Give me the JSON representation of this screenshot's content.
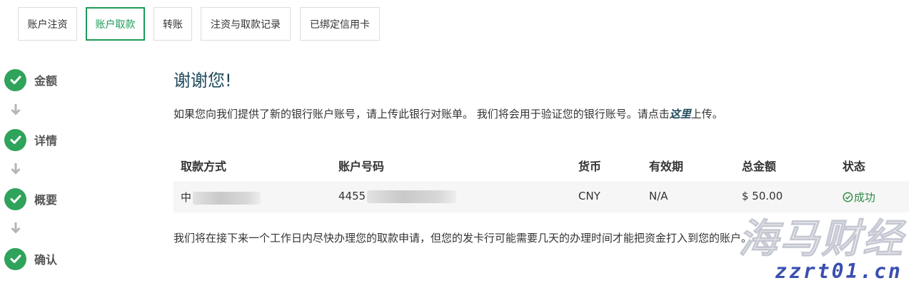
{
  "tabs": [
    {
      "label": "账户注资",
      "active": false
    },
    {
      "label": "账户取款",
      "active": true
    },
    {
      "label": "转账",
      "active": false
    },
    {
      "label": "注资与取款记录",
      "active": false
    },
    {
      "label": "已绑定信用卡",
      "active": false
    }
  ],
  "steps": [
    "金额",
    "详情",
    "概要",
    "确认"
  ],
  "heading": "谢谢您!",
  "intro": {
    "before": "如果您向我们提供了新的银行账户账号，请上传此银行对账单。 我们将会用于验证您的银行账号。请点击",
    "link": "这里",
    "after": "上传。"
  },
  "table": {
    "headers": [
      "取款方式",
      "账户号码",
      "货币",
      "有效期",
      "总金额",
      "状态"
    ],
    "row": {
      "method": "中",
      "account": "4455",
      "currency": "CNY",
      "expiry": "N/A",
      "amount": "$ 50.00",
      "status": "成功"
    }
  },
  "note": "我们将在接下来一个工作日内尽快办理您的取款申请，但您的发卡行可能需要几天的办理时间才能把资金打入到您的账户。",
  "watermark": {
    "title": "海马财经",
    "url": "zzrt01.cn"
  },
  "colors": {
    "accent": "#1e9b57",
    "step_check": "#2fa35b",
    "heading": "#1f4a5c",
    "success": "#2d8a46"
  }
}
